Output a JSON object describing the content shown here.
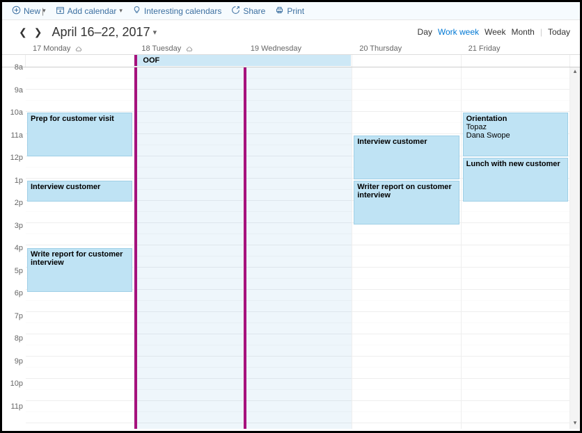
{
  "toolbar": {
    "new_label": "New",
    "add_calendar_label": "Add calendar",
    "interesting_label": "Interesting calendars",
    "share_label": "Share",
    "print_label": "Print"
  },
  "header": {
    "date_range": "April 16–22, 2017",
    "views": {
      "day": "Day",
      "work_week": "Work week",
      "week": "Week",
      "month": "Month",
      "today": "Today"
    }
  },
  "days": [
    {
      "label": "17 Monday",
      "weather": true,
      "busy": false
    },
    {
      "label": "18 Tuesday",
      "weather": true,
      "busy": true
    },
    {
      "label": "19 Wednesday",
      "weather": false,
      "busy": true
    },
    {
      "label": "20 Thursday",
      "weather": false,
      "busy": false
    },
    {
      "label": "21 Friday",
      "weather": false,
      "busy": false
    }
  ],
  "hours": [
    "8a",
    "9a",
    "10a",
    "11a",
    "12p",
    "1p",
    "2p",
    "3p",
    "4p",
    "5p",
    "6p",
    "7p",
    "8p",
    "9p",
    "10p",
    "11p"
  ],
  "allday": {
    "title": "OOF",
    "start_col": 1,
    "span": 2
  },
  "events": [
    {
      "day": 0,
      "title": "Prep for customer visit",
      "start": 10,
      "end": 12
    },
    {
      "day": 0,
      "title": "Interview customer",
      "start": 13,
      "end": 14
    },
    {
      "day": 0,
      "title": "Write report for customer interview",
      "start": 16,
      "end": 18
    },
    {
      "day": 3,
      "title": "Interview customer",
      "start": 11,
      "end": 13
    },
    {
      "day": 3,
      "title": "Writer report on customer interview",
      "start": 13,
      "end": 15
    },
    {
      "day": 4,
      "title": "Orientation",
      "loc": "Topaz",
      "who": "Dana Swope",
      "start": 10,
      "end": 12
    },
    {
      "day": 4,
      "title": "Lunch with new customer",
      "start": 12,
      "end": 14
    }
  ]
}
